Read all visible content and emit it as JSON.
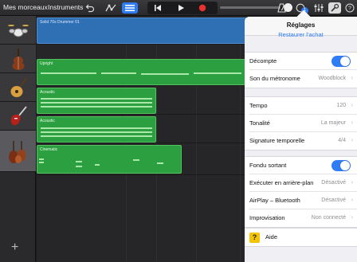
{
  "toolbar": {
    "my_songs_label": "Mes morceaux",
    "instruments_label": "Instruments",
    "icons": [
      "undo-icon",
      "smart-controls-icon",
      "tracks-view-icon",
      "rewind-icon",
      "play-icon",
      "record-icon",
      "metronome-icon",
      "notifications-icon",
      "mixer-icon",
      "settings-wrench-icon",
      "help-icon"
    ],
    "notification_count": "1",
    "accent_color": "#2e7cf6"
  },
  "tracks": [
    {
      "instrument": "drum-kit-icon",
      "region_name": "Solid 70s Drummer 01",
      "color": "#2f6fb4"
    },
    {
      "instrument": "upright-bass-icon",
      "region_name": "Upright",
      "color": "#2ca040"
    },
    {
      "instrument": "acoustic-guitar-icon",
      "region_name": "Acoustic",
      "color": "#2ca040"
    },
    {
      "instrument": "electric-guitar-icon",
      "region_name": "Acoustic",
      "color": "#2ca040"
    },
    {
      "instrument": "string-ensemble-icon",
      "region_name": "Cinematic",
      "color": "#2ca040"
    }
  ],
  "settings": {
    "title": "Réglages",
    "subtitle": "Restaurer l'achat",
    "group1": [
      {
        "label": "Décompte",
        "toggle": true
      },
      {
        "label": "Son du métronome",
        "value": "Woodblock"
      }
    ],
    "group2": [
      {
        "label": "Tempo",
        "value": "120"
      },
      {
        "label": "Tonalité",
        "value": "La majeur"
      },
      {
        "label": "Signature temporelle",
        "value": "4/4"
      }
    ],
    "group3": [
      {
        "label": "Fondu sortant",
        "toggle": true
      },
      {
        "label": "Exécuter en arrière-plan",
        "value": "Désactivé"
      },
      {
        "label": "AirPlay – Bluetooth",
        "value": "Désactivé"
      },
      {
        "label": "Improvisation",
        "value": "Non connecté"
      }
    ],
    "help_label": "Aide"
  }
}
